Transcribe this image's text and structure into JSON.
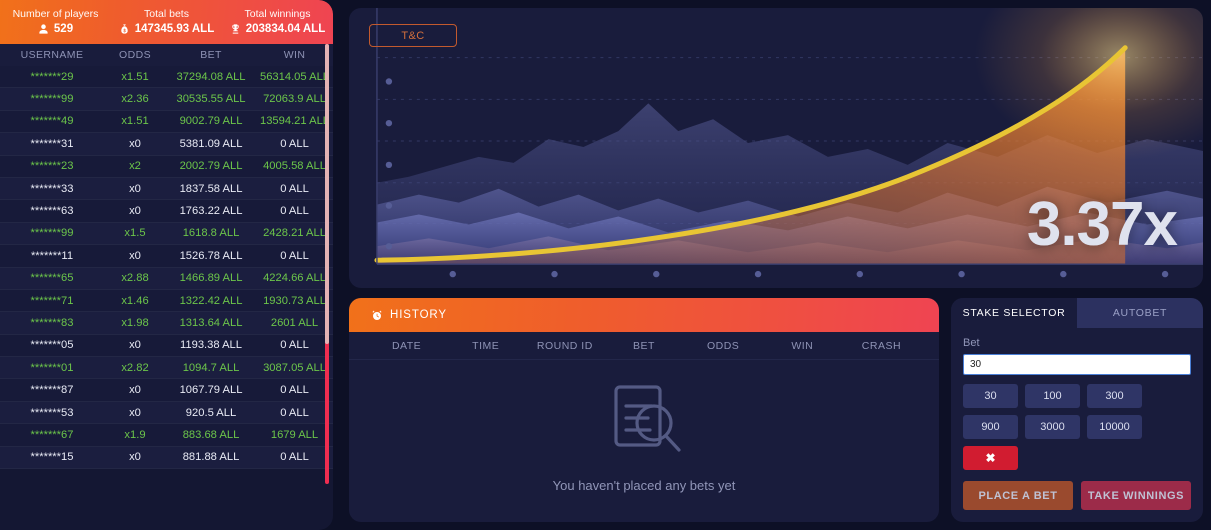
{
  "stats": [
    {
      "label": "Number of players",
      "value": "529",
      "icon": "user-icon"
    },
    {
      "label": "Total bets",
      "value": "147345.93 ALL",
      "icon": "money-bag-icon"
    },
    {
      "label": "Total winnings",
      "value": "203834.04 ALL",
      "icon": "trophy-icon"
    }
  ],
  "leaderboard": {
    "columns": [
      "USERNAME",
      "ODDS",
      "BET",
      "WIN"
    ],
    "rows": [
      {
        "username": "*******29",
        "odds": "x1.51",
        "bet": "37294.08 ALL",
        "win": "56314.05 ALL",
        "won": true
      },
      {
        "username": "*******99",
        "odds": "x2.36",
        "bet": "30535.55 ALL",
        "win": "72063.9 ALL",
        "won": true
      },
      {
        "username": "*******49",
        "odds": "x1.51",
        "bet": "9002.79 ALL",
        "win": "13594.21 ALL",
        "won": true
      },
      {
        "username": "*******31",
        "odds": "x0",
        "bet": "5381.09 ALL",
        "win": "0 ALL",
        "won": false
      },
      {
        "username": "*******23",
        "odds": "x2",
        "bet": "2002.79 ALL",
        "win": "4005.58 ALL",
        "won": true
      },
      {
        "username": "*******33",
        "odds": "x0",
        "bet": "1837.58 ALL",
        "win": "0 ALL",
        "won": false
      },
      {
        "username": "*******63",
        "odds": "x0",
        "bet": "1763.22 ALL",
        "win": "0 ALL",
        "won": false
      },
      {
        "username": "*******99",
        "odds": "x1.5",
        "bet": "1618.8 ALL",
        "win": "2428.21 ALL",
        "won": true
      },
      {
        "username": "*******11",
        "odds": "x0",
        "bet": "1526.78 ALL",
        "win": "0 ALL",
        "won": false
      },
      {
        "username": "*******65",
        "odds": "x2.88",
        "bet": "1466.89 ALL",
        "win": "4224.66 ALL",
        "won": true
      },
      {
        "username": "*******71",
        "odds": "x1.46",
        "bet": "1322.42 ALL",
        "win": "1930.73 ALL",
        "won": true
      },
      {
        "username": "*******83",
        "odds": "x1.98",
        "bet": "1313.64 ALL",
        "win": "2601 ALL",
        "won": true
      },
      {
        "username": "*******05",
        "odds": "x0",
        "bet": "1193.38 ALL",
        "win": "0 ALL",
        "won": false
      },
      {
        "username": "*******01",
        "odds": "x2.82",
        "bet": "1094.7 ALL",
        "win": "3087.05 ALL",
        "won": true
      },
      {
        "username": "*******87",
        "odds": "x0",
        "bet": "1067.79 ALL",
        "win": "0 ALL",
        "won": false
      },
      {
        "username": "*******53",
        "odds": "x0",
        "bet": "920.5 ALL",
        "win": "0 ALL",
        "won": false
      },
      {
        "username": "*******67",
        "odds": "x1.9",
        "bet": "883.68 ALL",
        "win": "1679 ALL",
        "won": true
      },
      {
        "username": "*******15",
        "odds": "x0",
        "bet": "881.88 ALL",
        "win": "0 ALL",
        "won": false
      }
    ]
  },
  "game": {
    "tc_label": "T&C",
    "multiplier": "3.37x",
    "plane_icon": "airplane-icon"
  },
  "chart_data": {
    "type": "line",
    "title": "",
    "xlabel": "",
    "ylabel": "",
    "x": [
      0,
      0.12,
      0.24,
      0.36,
      0.48,
      0.6,
      0.72,
      0.84,
      0.94,
      1.0
    ],
    "values": [
      1.0,
      1.05,
      1.14,
      1.28,
      1.5,
      1.78,
      2.1,
      2.55,
      3.0,
      3.37
    ],
    "ylim": [
      1.0,
      3.37
    ],
    "xlim": [
      0,
      1
    ],
    "grid": true,
    "legend": "none",
    "annotations": [
      "3.37x"
    ],
    "series": [
      {
        "name": "multiplier-curve",
        "values": [
          1.0,
          1.05,
          1.14,
          1.28,
          1.5,
          1.78,
          2.1,
          2.55,
          3.0,
          3.37
        ],
        "color": "#e8c534"
      }
    ],
    "y_axis_ticks": 5,
    "x_axis_ticks": 8
  },
  "history": {
    "title": "HISTORY",
    "icon": "clock-icon",
    "columns": [
      "DATE",
      "TIME",
      "ROUND ID",
      "BET",
      "ODDS",
      "WIN",
      "CRASH"
    ],
    "empty_message": "You haven't placed any bets yet",
    "empty_icon": "document-search-icon",
    "rows": []
  },
  "bet_panel": {
    "tabs": [
      {
        "label": "STAKE SELECTOR",
        "active": true
      },
      {
        "label": "AUTOBET",
        "active": false
      }
    ],
    "bet_label": "Bet",
    "bet_value": "30",
    "bet_placeholder": "30",
    "chips": [
      "30",
      "100",
      "300",
      "900",
      "3000",
      "10000"
    ],
    "clear_label": "✖",
    "place_bet_label": "PLACE A BET",
    "take_winnings_label": "TAKE WINNINGS"
  },
  "colors": {
    "brand_orange": "#f1711a",
    "brand_red": "#ef4452",
    "curve_yellow": "#e8c534",
    "win_green": "#6cc64a",
    "panel_bg": "#191c3c",
    "page_bg": "#0d1026"
  }
}
